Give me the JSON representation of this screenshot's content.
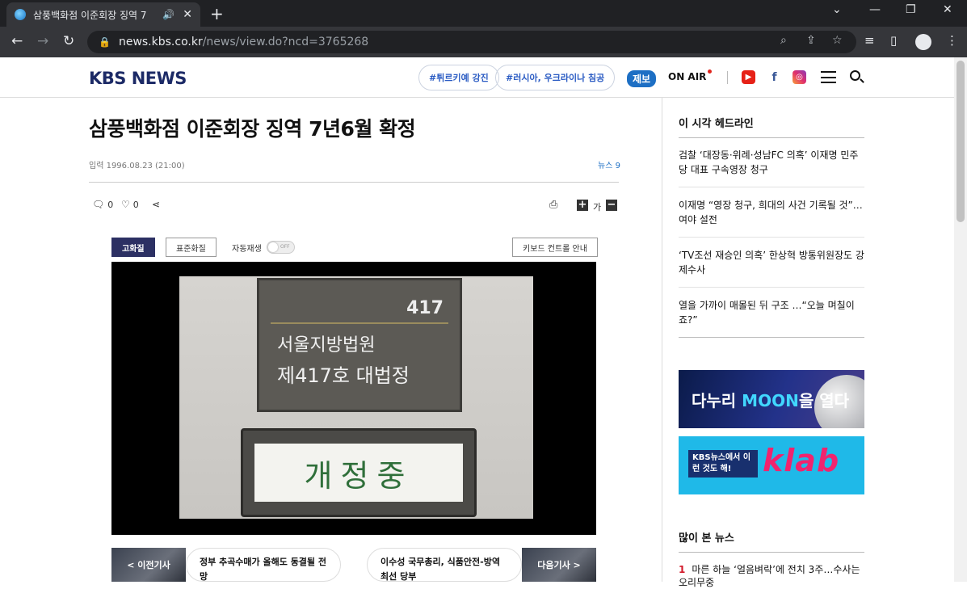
{
  "browser": {
    "tab_title": "삼풍백화점 이준회장 징역 7",
    "url_host": "news.kbs.co.kr",
    "url_path": "/news/view.do?ncd=3765268"
  },
  "site": {
    "logo": "KBS NEWS",
    "hashtags": [
      "#튀르키예 강진",
      "#러시아, 우크라이나 침공"
    ],
    "tip_label": "제보",
    "onair_label": "ON AIR",
    "font_control_label": "가"
  },
  "article": {
    "title": "삼풍백화점 이준회장 징역 7년6월 확정",
    "meta": "입력 1996.08.23 (21:00)",
    "program": "뉴스 9",
    "comments_count": "0",
    "likes_count": "0"
  },
  "video": {
    "hd_label": "고화질",
    "sd_label": "표준화질",
    "autoplay_label": "자동재생",
    "toggle_state": "OFF",
    "keyboard_help_label": "키보드 컨트롤 안내",
    "frame": {
      "plaque_number": "417",
      "plaque_line1": "서울지방법원",
      "plaque_line2": "제417호 대법정",
      "sign_text": "개정중"
    }
  },
  "related": {
    "prev_label": "< 이전기사",
    "prev_title": "정부 추곡수매가 올해도 동결될 전망",
    "next_title": "이수성 국무총리, 식품안전-방역 최선 당부",
    "next_label": "다음기사 >"
  },
  "sidebar": {
    "headline_title": "이 시각 헤드라인",
    "headlines": [
      "검찰 ‘대장동·위례·성남FC 의혹’ 이재명 민주당 대표 구속영장 청구",
      "이재명 “영장 청구, 희대의 사건 기록될 것”…여야 설전",
      "‘TV조선 재승인 의혹’ 한상혁 방통위원장도 강제수사",
      "열을 가까이 매몰된 뒤 구조 …“오늘 며칠이죠?”"
    ],
    "banner1_text_a": "다누리 ",
    "banner1_text_b": "MOON",
    "banner1_text_c": "을 열다",
    "banner2_text": "KBS뉴스에서 이런 것도 해!",
    "banner2_brand": "klab",
    "popular_title": "많이 본 뉴스",
    "popular": [
      {
        "rank": "1",
        "title": "마른 하늘 ‘얼음벼락’에 전치 3주…수사는 오리무중"
      }
    ]
  },
  "colors": {
    "brand_navy": "#1c2a66",
    "accent_blue": "#1d6fc4",
    "hd_button": "#2c3063",
    "rank_red": "#d21a2a"
  }
}
